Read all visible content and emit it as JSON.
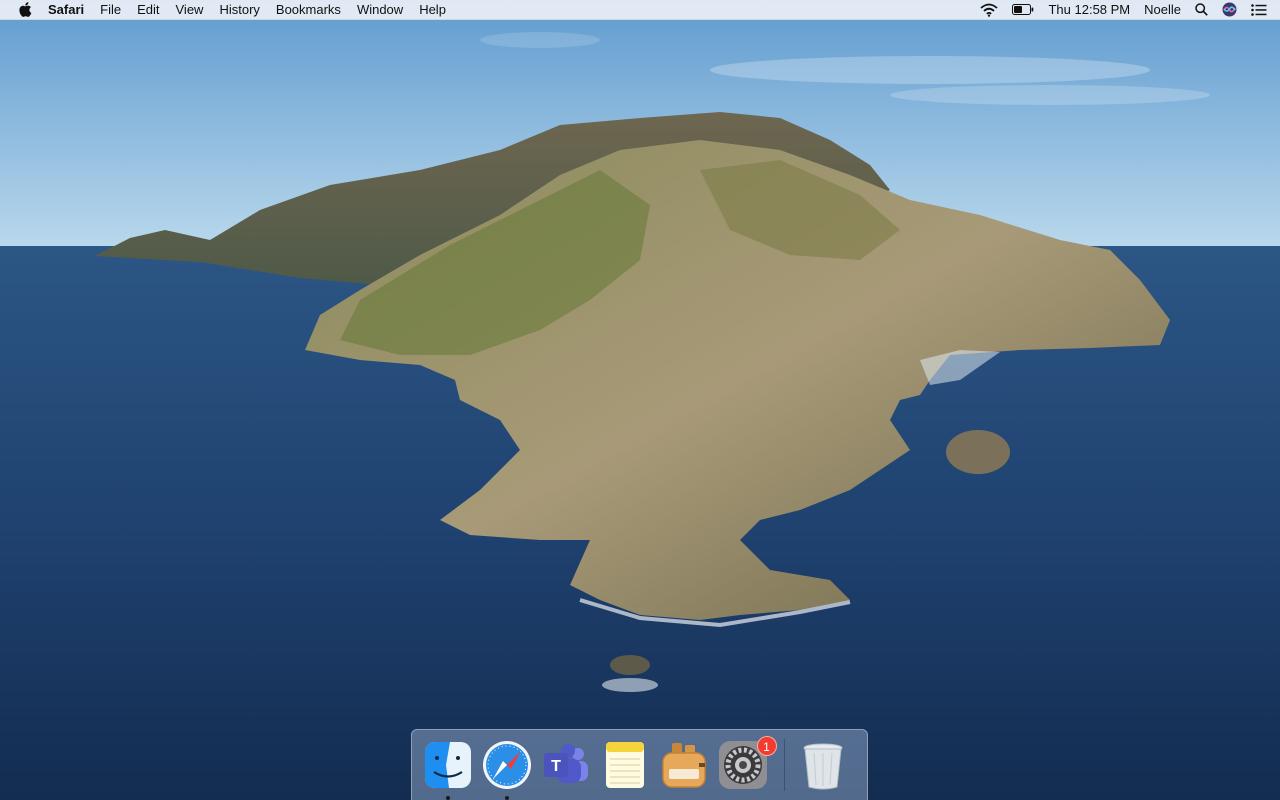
{
  "menubar": {
    "apple_icon": "apple-logo-icon",
    "app_name": "Safari",
    "menus": [
      "File",
      "Edit",
      "View",
      "History",
      "Bookmarks",
      "Window",
      "Help"
    ],
    "status": {
      "wifi_icon": "wifi-icon",
      "battery_icon": "battery-icon",
      "clock": "Thu 12:58 PM",
      "user": "Noelle",
      "spotlight_icon": "search-icon",
      "siri_icon": "siri-icon",
      "notification_icon": "notification-center-icon"
    }
  },
  "dock": {
    "apps": [
      {
        "name": "Finder",
        "icon": "finder-icon",
        "running": true
      },
      {
        "name": "Safari",
        "icon": "safari-compass-icon",
        "running": true
      },
      {
        "name": "Microsoft Teams",
        "icon": "teams-icon",
        "running": false
      },
      {
        "name": "Notes",
        "icon": "notes-icon",
        "running": false
      },
      {
        "name": "Toaster",
        "icon": "toaster-icon",
        "running": false
      },
      {
        "name": "System Preferences",
        "icon": "gear-icon",
        "running": false,
        "badge": "1"
      }
    ],
    "trash": {
      "name": "Trash",
      "icon": "trash-icon"
    }
  },
  "colors": {
    "sky": "#8fbfe0",
    "sea": "#1d3f6b",
    "badge": "#f33b30"
  }
}
